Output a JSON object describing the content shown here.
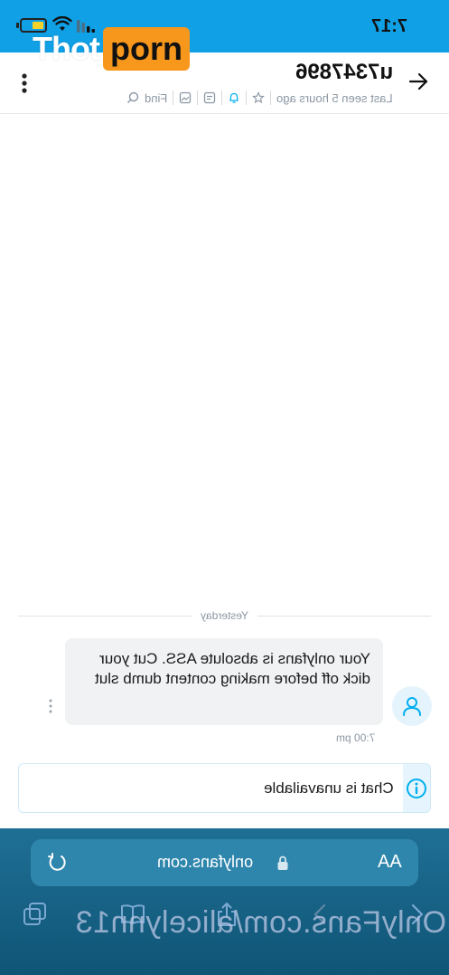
{
  "status_bar": {
    "time": "7:17",
    "icons": [
      "battery-icon",
      "wifi-icon",
      "signal-icon"
    ]
  },
  "watermark": {
    "logo_left": "Thot",
    "logo_right": "porn",
    "logo_accent": "#f7971c",
    "url": "OnlyFans.com/alicelynn13"
  },
  "header": {
    "username": "u7347896",
    "last_seen": "Last seen 5 hours ago",
    "find_label": "Find",
    "icons": [
      "back-arrow-icon",
      "star-icon",
      "bell-icon",
      "message-icon",
      "image-icon",
      "search-icon",
      "more-vertical-icon"
    ]
  },
  "chat": {
    "date_divider": "Yesterday",
    "messages": [
      {
        "text": "Your onlyfans is absolute ASS. Cut your dick off before making content dumb slut",
        "time": "7:00 pm"
      }
    ]
  },
  "notice": {
    "text": "Chat is unavailable",
    "icon": "info-icon"
  },
  "browser": {
    "url": "onlyfans.com",
    "text_size_label": "AA",
    "icons": [
      "reload-icon",
      "lock-icon",
      "tabs-icon",
      "bookmarks-icon",
      "share-icon",
      "forward-icon",
      "back-icon"
    ]
  },
  "colors": {
    "status_bar_bg": "#0fa0e6",
    "accent_blue": "#00aff0",
    "browser_bg": "#1f6f95"
  }
}
